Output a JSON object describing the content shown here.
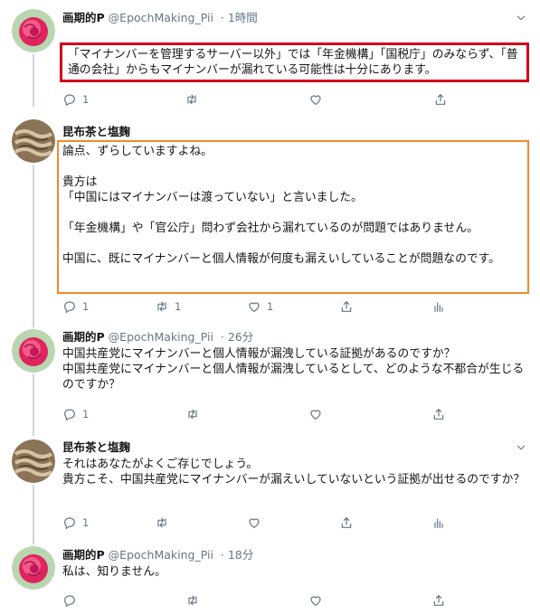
{
  "tweets": [
    {
      "name": "画期的P",
      "handle": "@EpochMaking_Pii",
      "time": "· 1時間",
      "text": "「マイナンバーを管理するサーバー以外」では「年金機構」「国税庁」のみならず、「普通の会社」からもマイナンバーが漏れている可能性は十分にあります。",
      "reply_count": "1",
      "retweet_count": "",
      "like_count": ""
    },
    {
      "name": "昆布茶と塩麹",
      "handle": "",
      "time": "",
      "text": "論点、ずらしていますよね。\n\n貴方は\n「中国にはマイナンバーは渡っていない」と言いました。\n\n「年金機構」や「官公庁」問わず会社から漏れているのが問題ではありません。\n\n中国に、既にマイナンバーと個人情報が何度も漏えいしていることが問題なのです。",
      "reply_count": "1",
      "retweet_count": "1",
      "like_count": "1"
    },
    {
      "name": "画期的P",
      "handle": "@EpochMaking_Pii",
      "time": "· 26分",
      "text": "中国共産党にマイナンバーと個人情報が漏洩している証拠があるのですか？\n中国共産党にマイナンバーと個人情報が漏洩しているとして、どのような不都合が生じるのですか？",
      "reply_count": "1",
      "retweet_count": "",
      "like_count": ""
    },
    {
      "name": "昆布茶と塩麹",
      "handle": "",
      "time": "",
      "text": "それはあなたがよくご存じでしょう。\n貴方こそ、中国共産党にマイナンバーが漏えいしていないという証拠が出せるのですか？",
      "reply_count": "1",
      "retweet_count": "",
      "like_count": ""
    },
    {
      "name": "画期的P",
      "handle": "@EpochMaking_Pii",
      "time": "· 18分",
      "text": "私は、知りません。",
      "reply_count": "",
      "retweet_count": "",
      "like_count": ""
    }
  ],
  "colors": {
    "highlight_red": "#d0021b",
    "highlight_orange": "#f0892c",
    "muted": "#657786",
    "thread_line": "#ccd6dd"
  },
  "icons": [
    "reply-icon",
    "retweet-icon",
    "like-icon",
    "share-icon",
    "analytics-icon",
    "caret-down-icon"
  ]
}
